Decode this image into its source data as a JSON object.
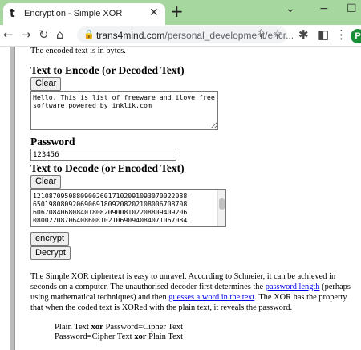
{
  "browser": {
    "tab_title": "Encryption - Simple XOR",
    "tab_favicon": "t",
    "url_host": "trans4mind.com",
    "url_path": "/personal_development/encr...",
    "profile_initial": "P"
  },
  "page": {
    "intro": "The encoded text is in bytes.",
    "encode_heading": "Text to Encode (or Decoded Text)",
    "clear_label": "Clear",
    "encode_text": "Hello, This is list of freeware and ilove free software powered by inklik.com",
    "password_heading": "Password",
    "password_value": "123456",
    "decode_heading": "Text to Decode (or Encoded Text)",
    "decode_text": "121087095088090026017102091093070022088065019088092069069018092082021082 0067087084 ...",
    "decode_lines": [
      "121087095088090026017102091093070022088",
      "650198080920690691809208202108006708708",
      "606708406808401808209008102208809409206",
      "080022087064086081021069094084071067084"
    ],
    "encrypt_label": "encrypt",
    "decrypt_label": "Decrypt",
    "para_1": "The Simple XOR ciphertext is easy to unravel. According to Schneier, it can be achieved in seconds on a computer. The unauthorised decoder first determines the ",
    "link_password_length": "password length",
    "para_2": " (perhaps using mathematical techniques) and then ",
    "link_guesses": "guesses a word in the text",
    "para_3": ". The XOR has the property that when the coded text is XORed with the plain text, it reveals the password.",
    "eq1_a": "Plain Text ",
    "eq1_op": "xor",
    "eq1_b": " Password=Cipher Text",
    "eq2_a": "Password=Cipher Text ",
    "eq2_op": "xor",
    "eq2_b": " Plain Text"
  }
}
